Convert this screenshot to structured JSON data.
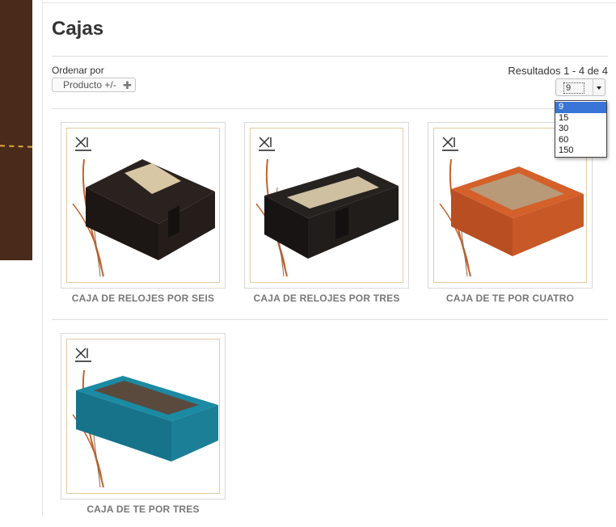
{
  "page": {
    "title": "Cajas"
  },
  "toolbar": {
    "sort_label": "Ordenar por",
    "sort_button_label": "Producto +/-",
    "sort_button_icon": "plus-icon",
    "results_text": "Resultados 1 - 4 de 4",
    "per_page": {
      "selected": "9",
      "options": [
        "9",
        "15",
        "30",
        "60",
        "150"
      ]
    }
  },
  "colors": {
    "brand_brown": "#4a2a1a",
    "accent_gold": "#e0a83a",
    "dropdown_highlight": "#3875d7"
  },
  "products": [
    {
      "name": "CAJA DE RELOJES POR SEIS",
      "box_color": "#2a221e",
      "weave": "vertical-panel"
    },
    {
      "name": "CAJA DE RELOJES POR TRES",
      "box_color": "#262220",
      "weave": "horizontal-panel"
    },
    {
      "name": "CAJA DE TE POR CUATRO",
      "box_color": "#d4602a",
      "weave": "square-window"
    },
    {
      "name": "CAJA DE TE POR TRES",
      "box_color": "#1b8aa3",
      "weave": "long-window"
    }
  ]
}
